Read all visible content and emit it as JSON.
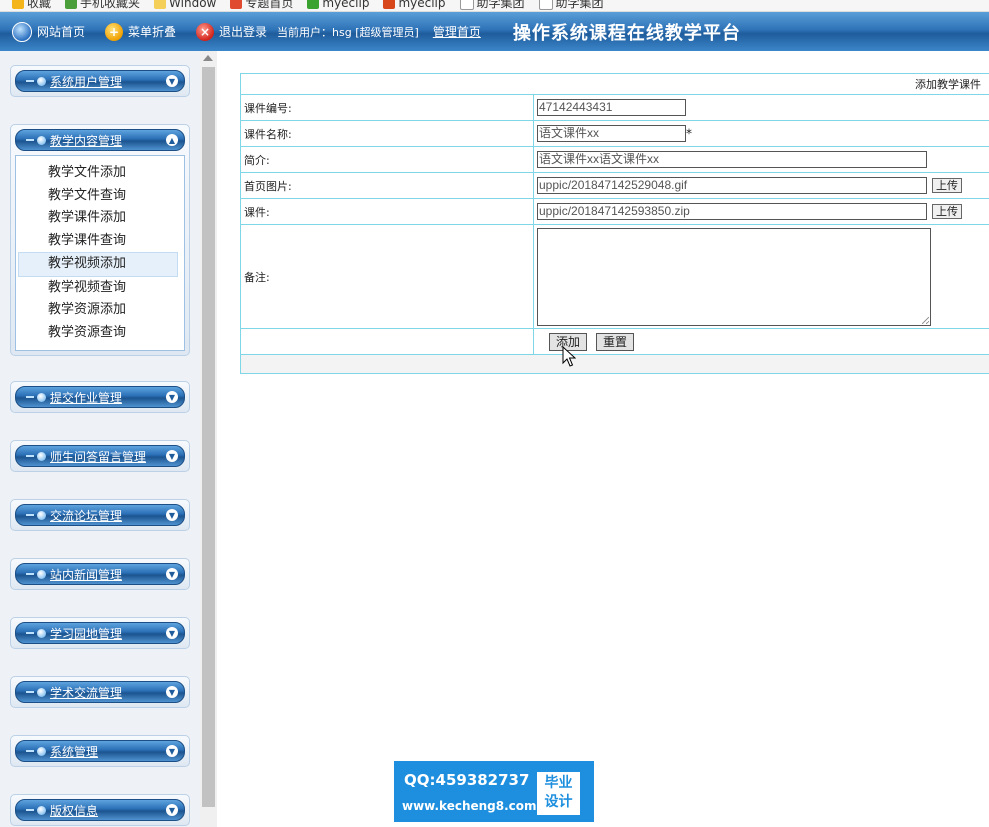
{
  "bookmarks": [
    {
      "label": "收藏",
      "icon": "star-icon"
    },
    {
      "label": "手机收藏夹",
      "icon": "phone-icon"
    },
    {
      "label": "Window",
      "icon": "folder-icon"
    },
    {
      "label": "专题首页",
      "icon": "page-icon"
    },
    {
      "label": "myeclip",
      "icon": "eclipse-icon"
    },
    {
      "label": "myeclip",
      "icon": "eclipse-icon"
    },
    {
      "label": "助学集团",
      "icon": "page-icon"
    },
    {
      "label": "助学集团",
      "icon": "page-icon"
    }
  ],
  "topbar": {
    "home": "网站首页",
    "collapse": "菜单折叠",
    "logout": "退出登录",
    "user": "当前用户：hsg [超级管理员]",
    "admin_home": "管理首页",
    "title": "操作系统课程在线教学平台"
  },
  "sidebar": {
    "groups": [
      {
        "label": "系统用户管理"
      },
      {
        "label": "教学内容管理",
        "items": [
          "教学文件添加",
          "教学文件查询",
          "教学课件添加",
          "教学课件查询",
          "教学视频添加",
          "教学视频查询",
          "教学资源添加",
          "教学资源查询"
        ],
        "active_index": 4
      },
      {
        "label": "提交作业管理"
      },
      {
        "label": "师生问答留言管理"
      },
      {
        "label": "交流论坛管理"
      },
      {
        "label": "站内新闻管理"
      },
      {
        "label": "学习园地管理"
      },
      {
        "label": "学术交流管理"
      },
      {
        "label": "系统管理"
      },
      {
        "label": "版权信息"
      }
    ]
  },
  "form": {
    "heading": "添加教学课件",
    "rows": [
      {
        "label": "课件编号:",
        "value": "47142443431"
      },
      {
        "label": "课件名称:",
        "value": "语文课件xx",
        "required_mark": "*"
      },
      {
        "label": "简介:",
        "value": "语文课件xx语文课件xx"
      },
      {
        "label": "首页图片:",
        "value": "uppic/201847142529048.gif",
        "upload": "上传"
      },
      {
        "label": "课件:",
        "value": "uppic/201847142593850.zip",
        "upload": "上传"
      },
      {
        "label": "备注:",
        "value": ""
      }
    ],
    "submit": "添加",
    "reset": "重置"
  },
  "watermark": {
    "qq": "QQ:459382737",
    "site": "www.kecheng8.com",
    "badge_line1": "毕业",
    "badge_line2": "设计"
  },
  "colors": {
    "header_blue": "#2f73b8",
    "table_border": "#7fd6e6",
    "watermark_blue": "#1e8fde"
  }
}
